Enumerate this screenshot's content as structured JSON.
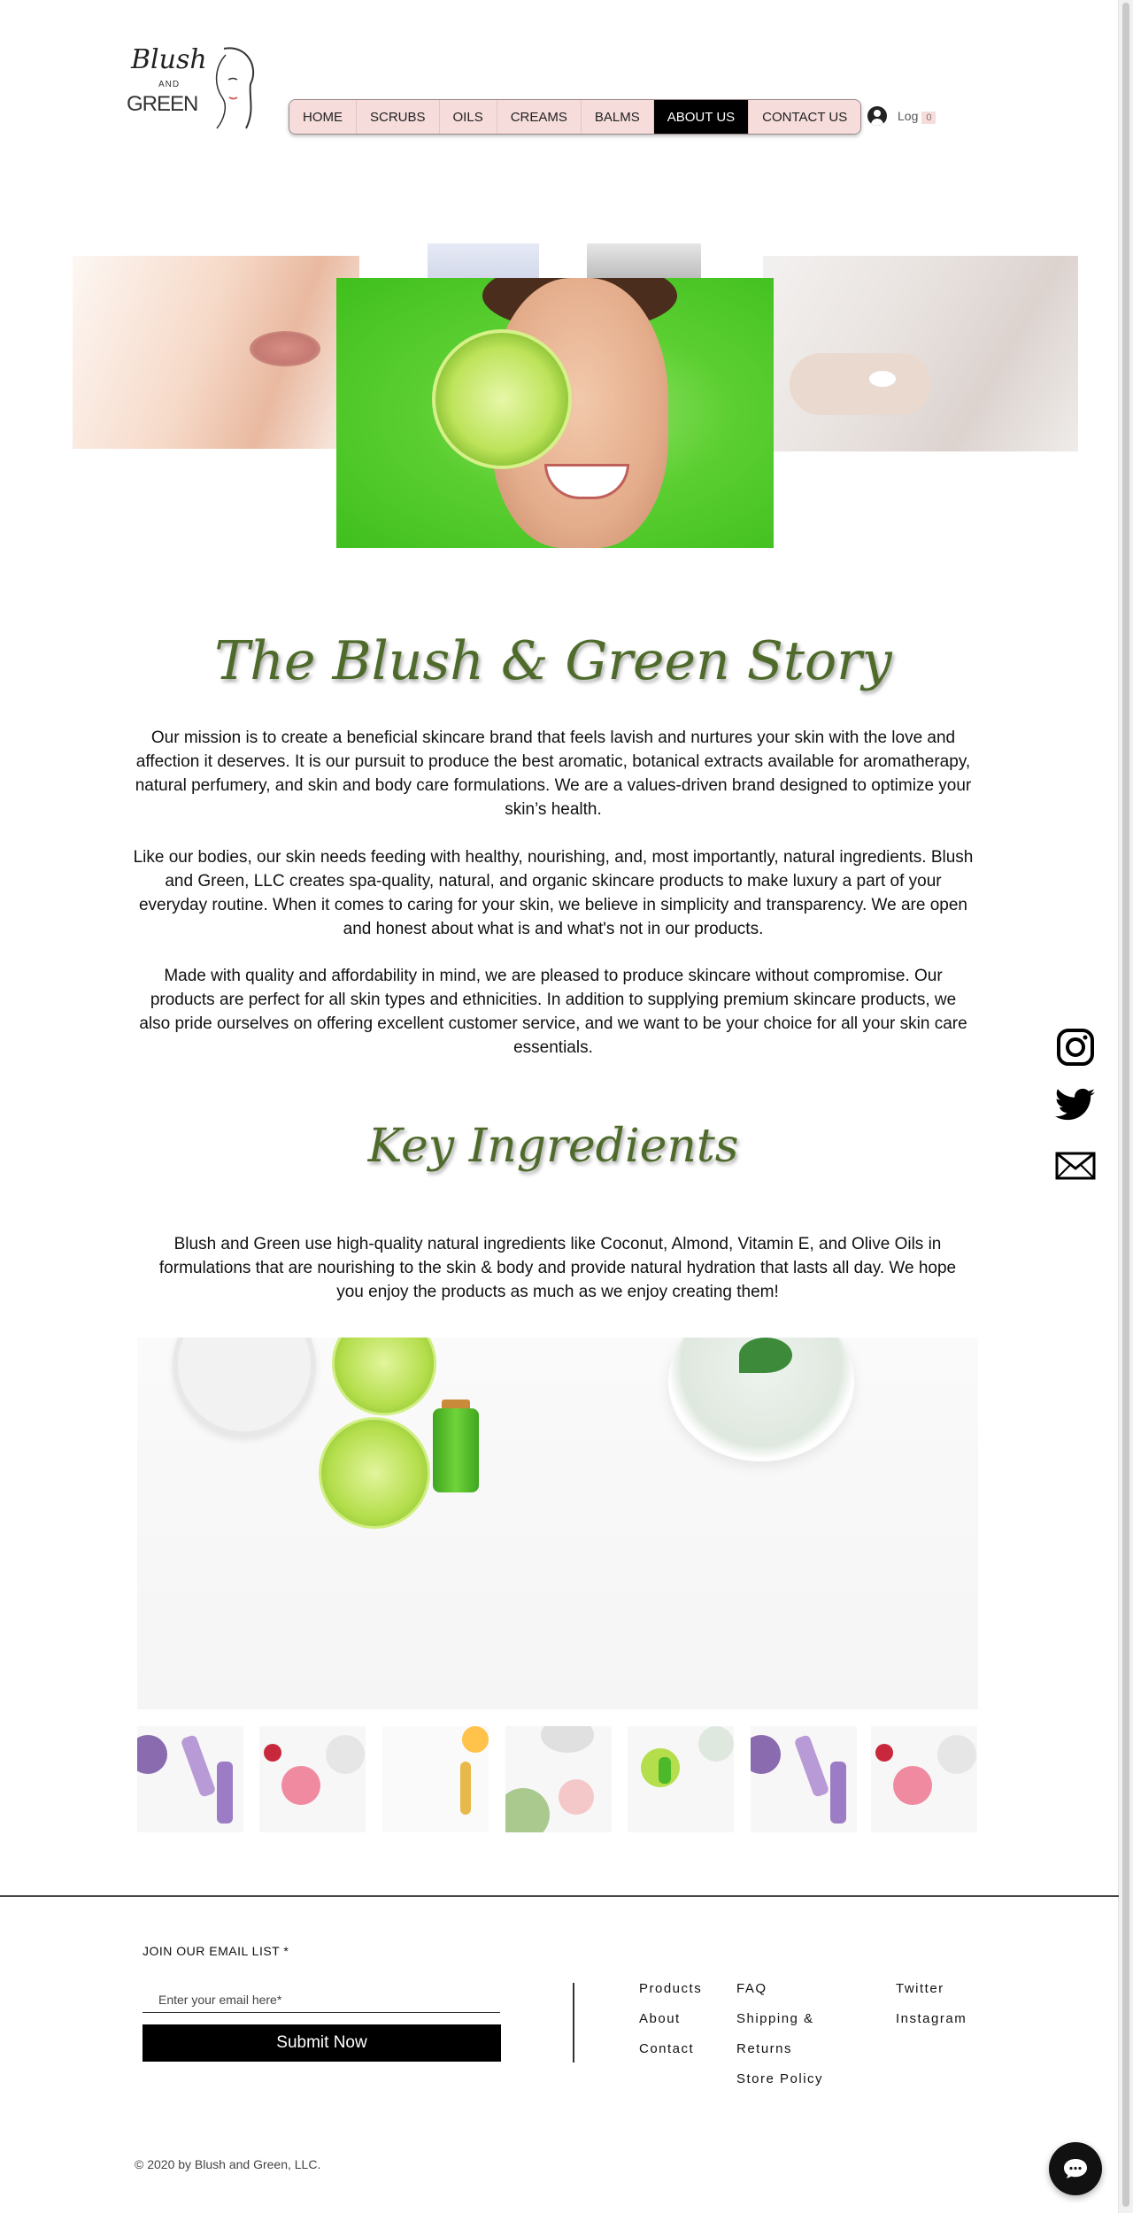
{
  "logo": {
    "script_text": "Blush",
    "and_text": "AND",
    "green_text": "GREEN"
  },
  "nav": {
    "items": [
      {
        "label": "HOME"
      },
      {
        "label": "SCRUBS"
      },
      {
        "label": "OILS"
      },
      {
        "label": "CREAMS"
      },
      {
        "label": "BALMS"
      },
      {
        "label": "ABOUT US",
        "active": true
      },
      {
        "label": "CONTACT US"
      }
    ]
  },
  "account": {
    "login_label": "Log",
    "cart_count": "0"
  },
  "story": {
    "title": "The Blush & Green Story",
    "paragraphs": [
      "Our mission is to create a beneficial skincare brand that feels lavish and nurtures your skin with the love and affection it deserves. It is our pursuit to produce the best aromatic, botanical extracts available for aromatherapy, natural perfumery, and skin and body care formulations. We are a values-driven brand designed to optimize your skin’s health.",
      "Like our bodies, our skin needs feeding with healthy, nourishing, and, most importantly, natural ingredients. Blush and Green, LLC creates spa-quality, natural, and organic skincare products to make luxury a part of your everyday routine. When it comes to caring for your skin, we believe in simplicity and transparency. We are open and honest about what is and what's not in our products.",
      "Made with quality and affordability in mind, we are pleased to produce skincare without compromise. Our products are perfect for all skin types and ethnicities. In addition to supplying premium skincare products, we also pride ourselves on offering excellent customer service, and we want to be your choice for all your skin care essentials."
    ]
  },
  "ingredients": {
    "title": "Key Ingredients",
    "text": "Blush and Green use high-quality natural ingredients like Coconut, Almond, Vitamin E, and Olive Oils in formulations that are nourishing to the skin & body and provide natural hydration that lasts all day. We hope you enjoy the products as much as we enjoy creating them!"
  },
  "social": {
    "icons": [
      "instagram-icon",
      "twitter-icon",
      "email-icon"
    ]
  },
  "footer": {
    "email_label": "JOIN OUR EMAIL LIST *",
    "email_placeholder": "Enter your email here*",
    "submit_label": "Submit Now",
    "col1": [
      "Products",
      "About",
      "Contact"
    ],
    "col2": [
      "FAQ",
      "Shipping &",
      "Returns",
      "Store Policy"
    ],
    "col3": [
      "Twitter",
      "Instagram"
    ],
    "copyright": "© 2020 by Blush and Green, LLC."
  }
}
